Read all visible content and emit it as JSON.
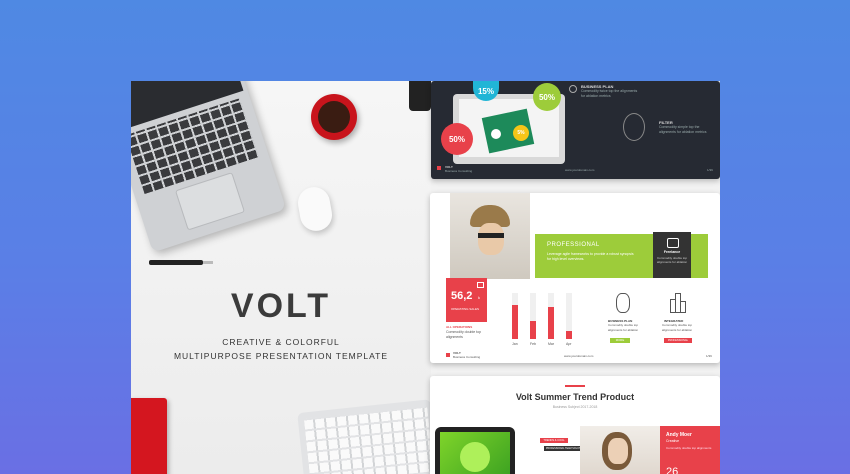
{
  "hero": {
    "title": "VOLT",
    "subtitle_line1": "CREATIVE & COLORFUL",
    "subtitle_line2": "MULTIPURPOSE PRESENTATION TEMPLATE"
  },
  "slide1": {
    "circles": [
      "15%",
      "50%",
      "50%",
      "5%"
    ],
    "feature1_title": "BUSINESS PLAN",
    "feature1_text": "Commodity twice top the alignments for ablation metrics",
    "feature2_title": "FILTER",
    "feature2_text": "Commodity simple top the alignments for ablation metrics",
    "footer_brand": "VOLT",
    "footer_sub": "Business Consulting",
    "footer_url": "www.yourdomain.com",
    "page": "1/39"
  },
  "slide2": {
    "banner_title": "PROFESSIONAL",
    "banner_text": "Leverage agile frameworks to provide a robust synopsis for high level overviews.",
    "icon_label": "Freelance",
    "icon_text": "Commodity double top alignments for ablation",
    "stat_value": "56,2",
    "stat_unit": "k",
    "stat_caption": "OPERATING SALES",
    "stat_note_title": "ALL OPERATIONS",
    "stat_note": "Commodity double top alignments",
    "chart_x": [
      "Jan",
      "Feb",
      "Mar",
      "Apr"
    ],
    "feature1_title": "BUSINESS PLAN",
    "feature1_text": "Commodity double top alignments for ablation",
    "feature1_button": "MORE",
    "feature2_title": "INTEGRATED",
    "feature2_text": "Commodity double top alignments for ablation",
    "feature2_button": "PROFESSIONAL",
    "footer_brand": "VOLT",
    "footer_sub": "Business Consulting",
    "footer_url": "www.yourdomain.com",
    "page": "1/39"
  },
  "slide3": {
    "title": "Volt Summer Trend Product",
    "subtitle": "Business Subject 2017-2018",
    "tag1": "TRENDS & COOL",
    "tag2": "PROFESSIONAL TEAM SOLUTIONS",
    "person_name": "Andy Moer",
    "person_role": "Creative",
    "person_note": "Commodity double top alignments",
    "person_number": "26"
  },
  "colors": {
    "accent_red": "#e8414a",
    "accent_green": "#9dcc3a",
    "slide_dark": "#262a33"
  }
}
